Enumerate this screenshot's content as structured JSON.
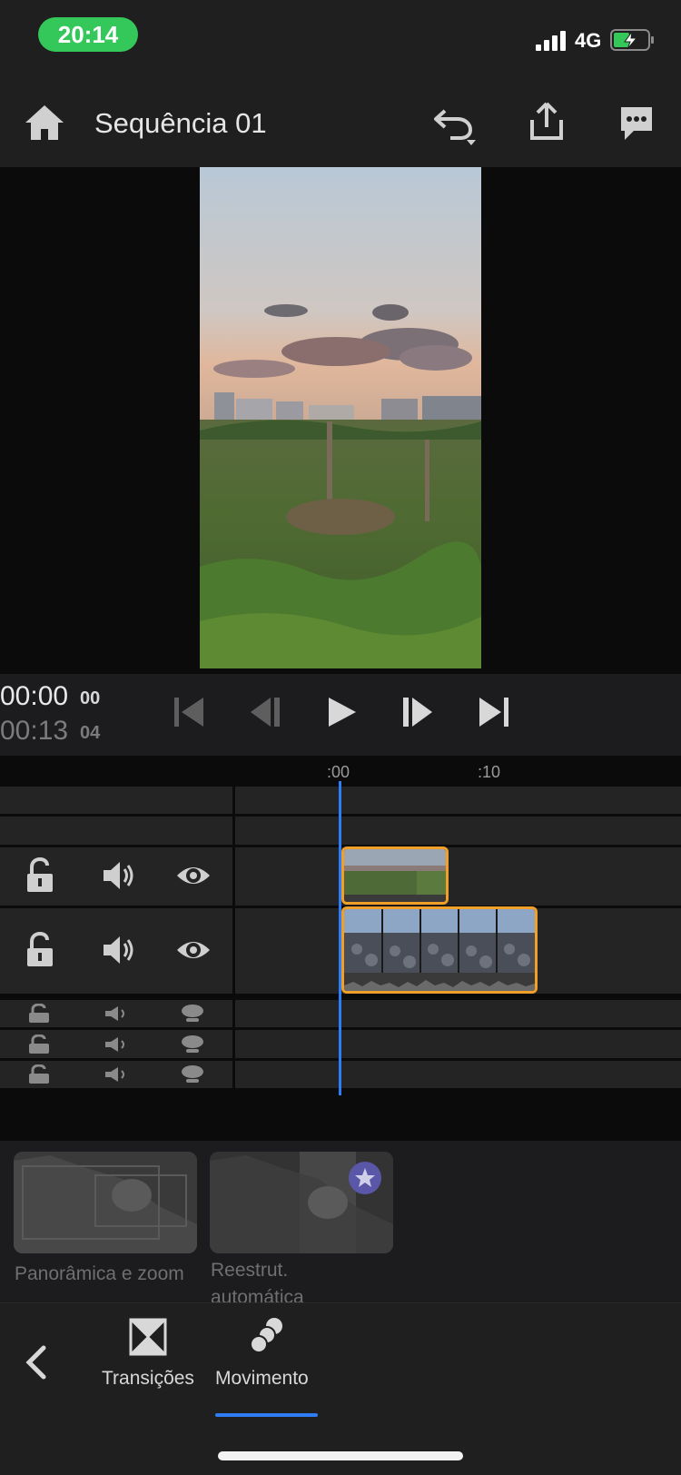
{
  "status_bar": {
    "time": "20:14",
    "network": "4G"
  },
  "header": {
    "title": "Sequência 01"
  },
  "player": {
    "current_time": "00:00",
    "current_frames": "00",
    "total_time": "00:13",
    "total_frames": "04"
  },
  "ruler": {
    "ticks": [
      ":00",
      ":10"
    ]
  },
  "effects": {
    "items": [
      {
        "label": "Panorâmica e zoom"
      },
      {
        "label_line1": "Reestrut.",
        "label_line2": "automática"
      }
    ]
  },
  "bottom_tabs": {
    "transitions": "Transições",
    "motion": "Movimento",
    "active": "motion"
  },
  "colors": {
    "accent_blue": "#2f7df6",
    "clip_border": "#f0a028",
    "status_green": "#34c759"
  }
}
